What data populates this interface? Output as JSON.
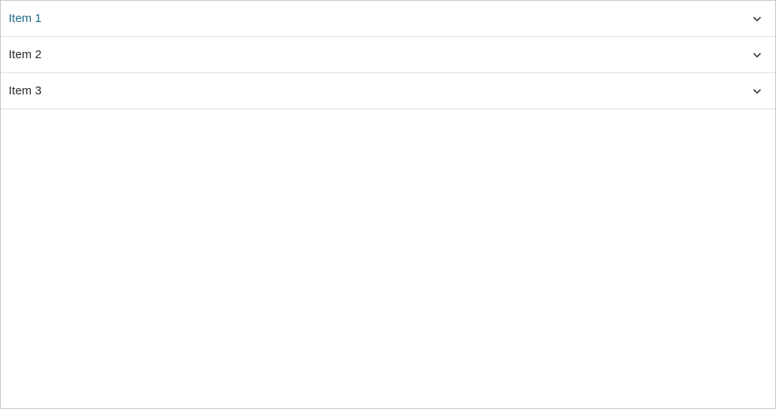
{
  "accordion": {
    "items": [
      {
        "label": "Item 1",
        "selected": true
      },
      {
        "label": "Item 2",
        "selected": false
      },
      {
        "label": "Item 3",
        "selected": false
      }
    ]
  }
}
